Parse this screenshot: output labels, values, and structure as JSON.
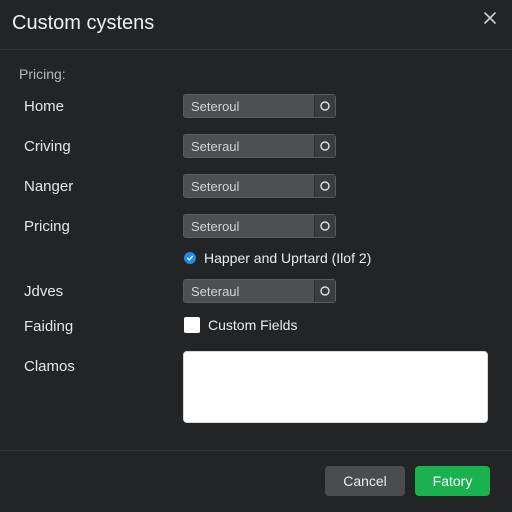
{
  "dialog": {
    "title": "Custom cystens",
    "close_icon": "close-icon"
  },
  "section": {
    "label": "Pricing:"
  },
  "rows": [
    {
      "label": "Home",
      "value": "Seterоul"
    },
    {
      "label": "Criving",
      "value": "Seterаul"
    },
    {
      "label": "Nanger",
      "value": "Seterоul"
    },
    {
      "label": "Pricing",
      "value": "Seterоul"
    }
  ],
  "option_checked": {
    "text": "Happer and Uprtard (Ilof 2)",
    "checked": true
  },
  "row_adves": {
    "label": "Jdves",
    "value": "Seterаul"
  },
  "fields_row": {
    "label": "Faiding",
    "checkbox_text": "Custom Fields",
    "checked": false
  },
  "notes": {
    "label": "Clamos",
    "value": ""
  },
  "footer": {
    "cancel": "Cancel",
    "primary": "Fatory"
  },
  "colors": {
    "primary": "#19b24e",
    "check_accent": "#1f8ceb",
    "background": "#222426"
  }
}
